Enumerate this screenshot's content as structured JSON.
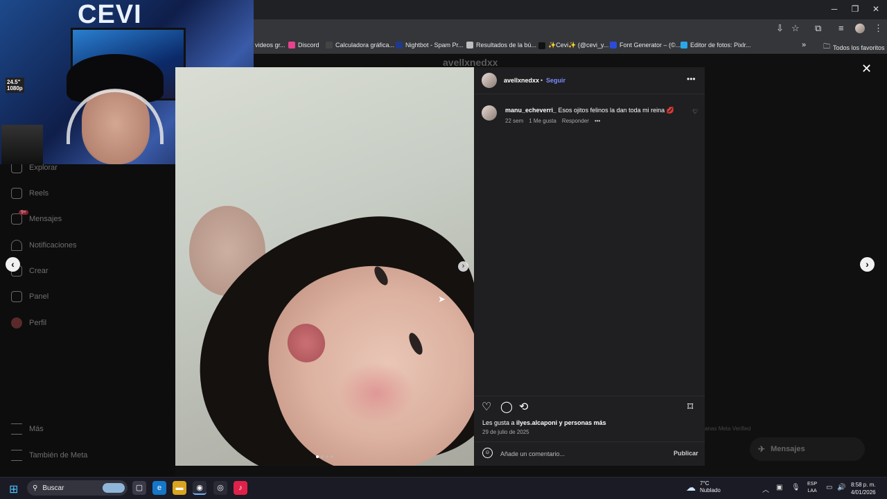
{
  "browser": {
    "bookmarks": [
      {
        "label": "videos gr...",
        "color": "#888888"
      },
      {
        "label": "Discord",
        "color": "#e8418f"
      },
      {
        "label": "Calculadora gráfica...",
        "color": "#444444"
      },
      {
        "label": "Nightbot - Spam Pr...",
        "color": "#1e3a8a"
      },
      {
        "label": "Resultados de la bú...",
        "color": "#bfbfbf"
      },
      {
        "label": "✨Cevi✨ (@cevi_y...",
        "color": "#111111"
      },
      {
        "label": "Font Generator – (©...",
        "color": "#2b4bd8"
      },
      {
        "label": "Editor de fotos: Pixlr...",
        "color": "#2aa7e8"
      }
    ],
    "bookmarks_more": "»",
    "all_favorites": "Todos los favoritos",
    "window_controls": {
      "minimize": "─",
      "maximize": "❐",
      "close": "✕"
    }
  },
  "webcam": {
    "logo": "CEVI",
    "monitor_label": "24.5\"\n1080p"
  },
  "sidebar": {
    "items": [
      {
        "label": "Explorar",
        "icon": "compass-icon"
      },
      {
        "label": "Reels",
        "icon": "reels-icon"
      },
      {
        "label": "Mensajes",
        "icon": "messages-icon",
        "badge": "9+"
      },
      {
        "label": "Notificaciones",
        "icon": "heart-icon"
      },
      {
        "label": "Crear",
        "icon": "plus-icon"
      },
      {
        "label": "Panel",
        "icon": "chart-icon"
      },
      {
        "label": "Perfil",
        "icon": "profile-icon"
      }
    ],
    "more": "Más",
    "meta": "También de Meta"
  },
  "background": {
    "username": "avellxnedxx",
    "footer_text": "anas   Meta Verified",
    "messages_pill": "Mensajes",
    "messages_badge": "9+"
  },
  "post": {
    "author": "avellxnedxx",
    "separator": "•",
    "follow_label": "Seguir",
    "more": "•••",
    "comment": {
      "username": "manu_echeverri_",
      "text": " Esos ojitos felinos la dan toda mi reina 💋",
      "time": "22 sem",
      "likes": "1 Me gusta",
      "reply": "Responder",
      "more": "•••"
    },
    "likes_prefix": "Les gusta a ",
    "likes_user": "ilyes.alcaponi",
    "likes_suffix": " y personas más",
    "date": "29 de julio de 2025",
    "comment_placeholder": "Añade un comentario...",
    "publish_label": "Publicar",
    "close": "✕",
    "carousel": {
      "count": 4,
      "active": 0
    }
  },
  "taskbar": {
    "search_label": "Buscar",
    "weather_temp": "7°C",
    "weather_desc": "Nublado",
    "lang_top": "ESP",
    "lang_bottom": "LAA",
    "time": "8:58 p. m.",
    "date": "4/01/2026"
  }
}
